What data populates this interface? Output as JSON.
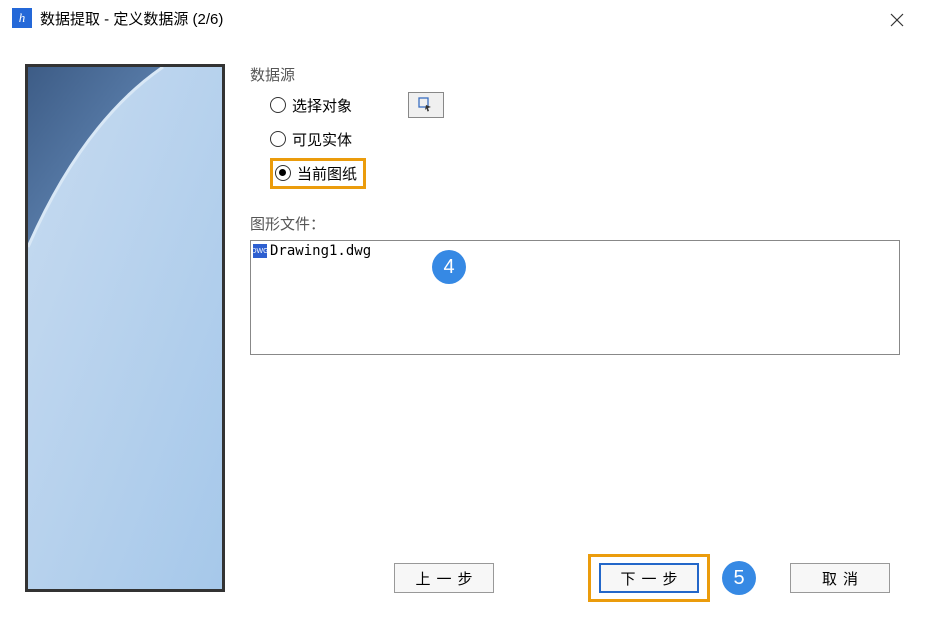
{
  "titlebar": {
    "title": "数据提取 - 定义数据源 (2/6)"
  },
  "dataSource": {
    "groupLabel": "数据源",
    "option1": "选择对象",
    "option2": "可见实体",
    "option3": "当前图纸"
  },
  "drawingFiles": {
    "label": "图形文件：",
    "items": [
      "Drawing1.dwg"
    ],
    "fileIconText": "DWG"
  },
  "buttons": {
    "prev": "上一步",
    "next": "下一步",
    "cancel": "取消"
  },
  "annotations": {
    "step4": "4",
    "step5": "5"
  }
}
